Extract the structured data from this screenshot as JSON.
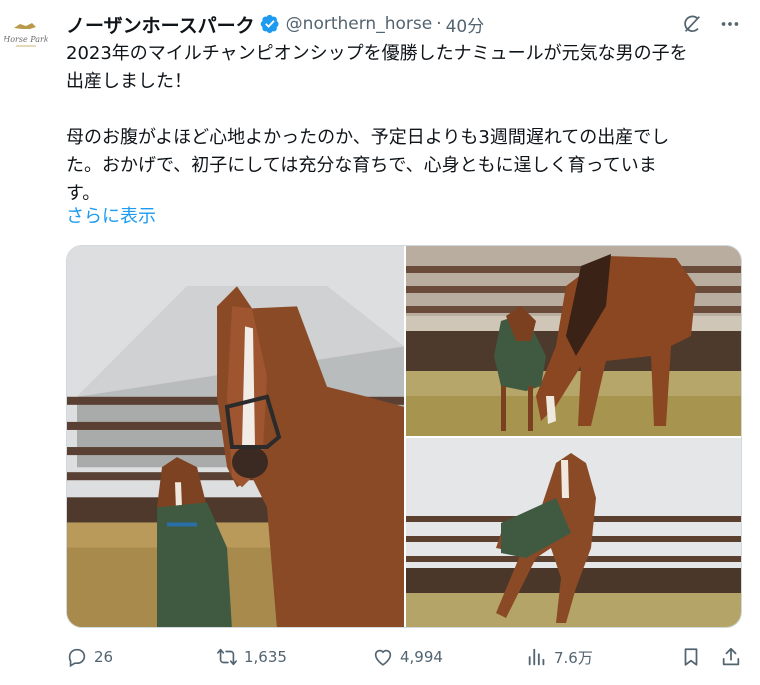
{
  "author": {
    "display_name": "ノーザンホースパーク",
    "handle": "@northern_horse",
    "separator": "·",
    "time": "40分",
    "avatar_icon": "northern-horse-park-logo",
    "verified_color": "#1d9bf0"
  },
  "header_actions": {
    "grok_icon": "grok-icon",
    "more_icon": "more-dots-icon"
  },
  "tweet": {
    "para1_line1": "2023年のマイルチャンピオンシップを優勝したナミュールが元気な男の子を",
    "para1_line2": "出産しました！",
    "para2_line1": "母のお腹がよほど心地よかったのか、予定日よりも3週間遅れての出産でし",
    "para2_line2": "た。おかげで、初子にしては充分な育ちで、心身ともに逞しく育っていま",
    "para2_line3": "す。",
    "show_more": "さらに表示"
  },
  "media": {
    "photos": [
      {
        "subject": "mare-and-foal-portrait"
      },
      {
        "subject": "mare-grazing-with-foal"
      },
      {
        "subject": "foal-rearing-in-paddock"
      }
    ]
  },
  "actions": {
    "replies": "26",
    "retweets": "1,635",
    "likes": "4,994",
    "views": "7.6万",
    "icon_color": "#536471"
  },
  "colors": {
    "link": "#1d9bf0",
    "text": "#0f1419",
    "secondary": "#536471",
    "border": "#cfd9de"
  }
}
